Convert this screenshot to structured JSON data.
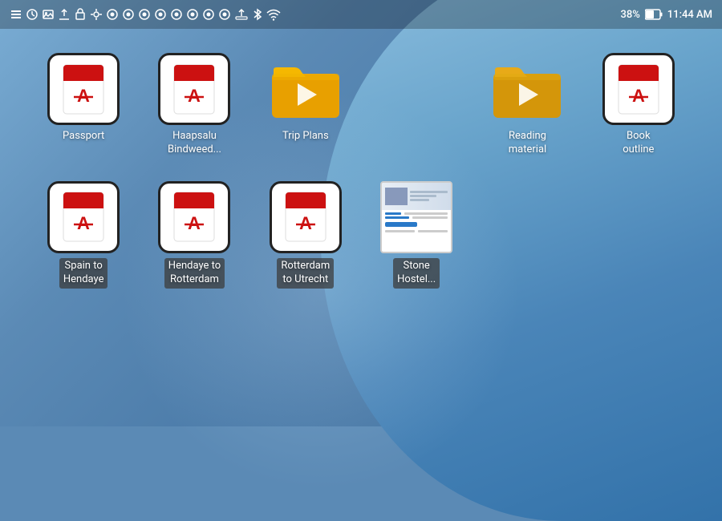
{
  "statusBar": {
    "battery": "38%",
    "time": "11:44 AM"
  },
  "apps": {
    "row1": [
      {
        "id": "passport",
        "type": "pdf",
        "label": "Passport",
        "darkLabel": false
      },
      {
        "id": "haapsalu",
        "type": "pdf",
        "label": "Haapsalu\nBindweed...",
        "darkLabel": false
      },
      {
        "id": "trip-plans",
        "type": "folder-orange",
        "label": "Trip Plans",
        "darkLabel": false
      },
      {
        "id": "empty",
        "type": "empty",
        "label": ""
      },
      {
        "id": "reading-material",
        "type": "folder-yellow",
        "label": "Reading\nmaterial",
        "darkLabel": false
      },
      {
        "id": "book-outline",
        "type": "pdf",
        "label": "Book\noutline",
        "darkLabel": false
      }
    ],
    "row2": [
      {
        "id": "spain-hendaye",
        "type": "pdf",
        "label": "Spain to\nHendaye",
        "darkLabel": true
      },
      {
        "id": "hendaye-rotterdam",
        "type": "pdf",
        "label": "Hendaye to\nRotterdam",
        "darkLabel": true
      },
      {
        "id": "rotterdam-utrecht",
        "type": "pdf",
        "label": "Rotterdam\nto Utrecht",
        "darkLabel": true
      },
      {
        "id": "stone-hostel",
        "type": "thumbnail",
        "label": "Stone\nHostel...",
        "darkLabel": true
      },
      {
        "id": "empty2",
        "type": "empty",
        "label": ""
      },
      {
        "id": "empty3",
        "type": "empty",
        "label": ""
      }
    ]
  }
}
